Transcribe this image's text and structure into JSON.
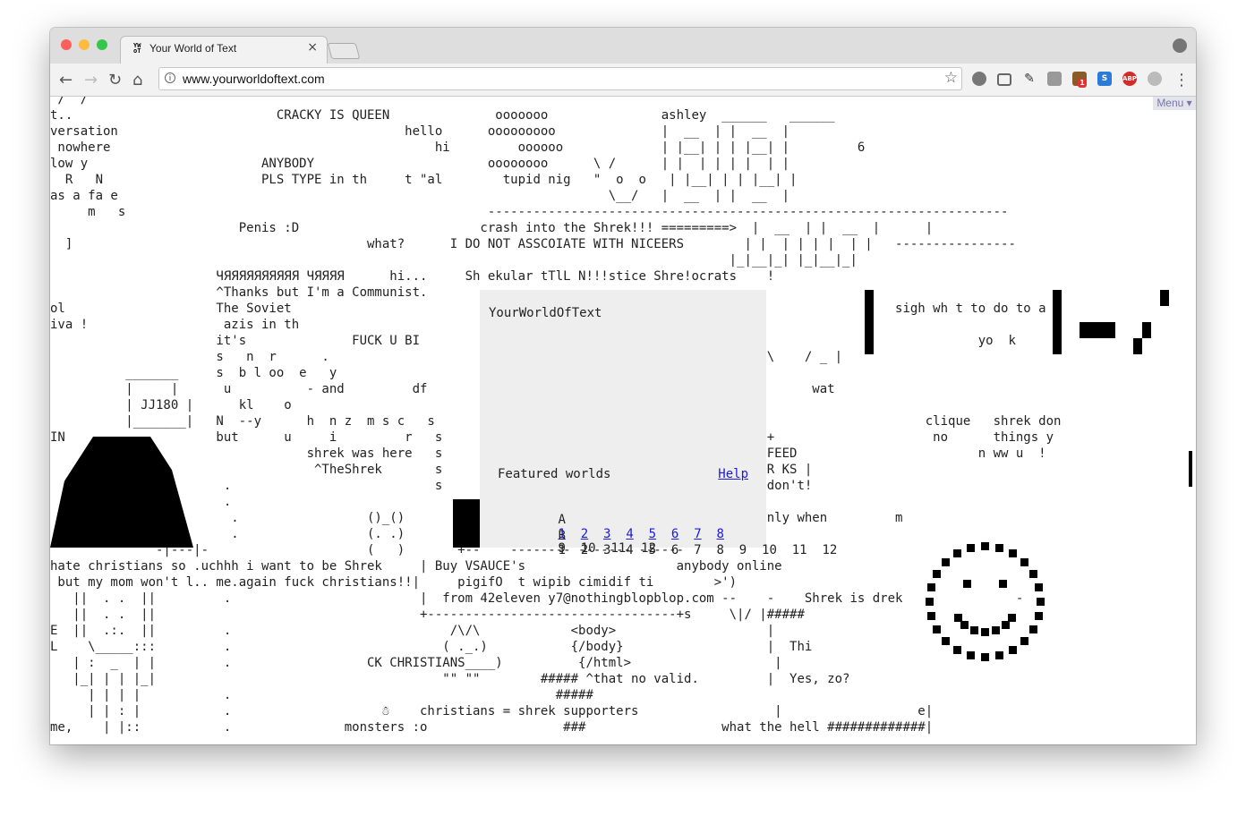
{
  "browser": {
    "tab_title": "Your World of Text",
    "tab_favicon": "YW oT",
    "tab_close": "×",
    "url": "www.yourworldoftext.com",
    "nav_back": "←",
    "nav_forward": "→",
    "nav_reload": "↻",
    "nav_home": "⌂",
    "info_glyph": "i",
    "bookmark_star": "☆",
    "extensions": [
      "refresh-icon",
      "screen-icon",
      "pin-icon",
      "camera-icon",
      "extension-badge-icon",
      "s-icon",
      "abp-icon",
      "cloud-icon"
    ],
    "abp_label": "ABP",
    "s_label": "S",
    "badge_count": "1",
    "menu_dots": "⋮"
  },
  "canvas": {
    "menu_label": "Menu ▾",
    "lines": [
      " /  /",
      "t..                           CRACKY IS QUEEN              ooooooo               ashley  ______   ______",
      "versation                                      hello      ooooooooo              |  __  | |  __  |",
      " nowhere                                           hi         oooooo             | |__| | | |__| |         6",
      "low y                       ANYBODY                       oooooooo      \\ /      | |  | | | |  | |",
      "  R   N                     PLS TYPE in th     t \"al        tupid nig   \"  o  o   | |__| | | |__| |",
      "as a fa e                                                                 \\__/   |  __  | |  __  |",
      "     m   s                                                ---------------------------------------------------------------------",
      "                         Penis :D                        crash into the Shrek!!! =========>  |  __  | |  __  |      |",
      "  ]                                       what?      I DO NOT ASSCOIATE WITH NICEERS        | |  | | | |  | |   ----------------",
      "                                                                                          |_|__|_| |_|__|_|",
      "                      ЧЯЯЯЯЯЯЯЯЯЯ ЧЯЯЯЯ      hi...     Sh ekular tTlL N!!!stice Shre!ocrats    !",
      "                      ^Thanks but I'm a Communist.",
      "ol                    The Soviet                                                                                sigh wh t to do to a",
      "iva !                  azis in th",
      "                      it's              FUCK U BI                                                                          yo  k",
      "                      s   n  r      .                                                      \\ / \\    / _ |",
      "          _______     s  b l oo  e   y",
      "          |     |      u          - and         df                                                   wat",
      "          | JJ180 |      kl    o",
      "          |_______|   N  --y      h  n z  m s c   s                                                                 clique   shrek don",
      "IN                    but      u     i         r   s                                        ---+                     no      things y",
      "                                  shrek was here   s                                    |      FEED                        n ww u  !",
      "                                   ^TheShrek       s                                    |  E SHR KS |",
      "                       .                           s                                    |   - -don't!",
      "                       .                                                                           ",
      "                        .                 ()_()                                              genly when         m",
      "                        .                 (. .)",
      "              -|---|-                     (   )       +--    -------- ------- ------",
      "hate christians so .uchhh i want to be Shrek     | Buy VSAUCE's                    anybody online",
      " but my mom won't l.. me.again fuck christians!!|     pigifO  t wipib cimidif ti        >')",
      "   ||  . .  ||         .                         |  from 42eleven y7@nothingblopblop.com --    -    Shrek is drek               -",
      "   ||  . .  ||                                   +---------------------------------+s     \\|/ |#####",
      "E  ||  .:.  ||         .                             /\\/\\            <body>                    |",
      "L    \\_____:::         .                            ( ._.)           {/body}                   |  Thi",
      "   | :  _  | |         .                  CK CHRISTIANS____)          {/html>                   |",
      "   |_| | | |_|                                      \"\" \"\"        ##### ^that no valid.         |  Yes, zo?",
      "     | | | |           .                                           #####",
      "     | | : |           .                    ☃    christians = shrek supporters                  |                  e|",
      "me,    | |::           .               monsters :o                  ###                  what the hell #############|"
    ]
  },
  "panel": {
    "title": "YourWorldOfText",
    "featured_label": "Featured worlds",
    "help_label": "Help",
    "row_a_label": "A",
    "row_b_label": "B",
    "row_a_links": [
      "1",
      "2",
      "3",
      "4",
      "5",
      "6",
      "7",
      "8"
    ],
    "row_a_plain": "9  10  11  12",
    "row_b_plain": "1  2  3  4  5  6  7  8  9  10  11  12"
  }
}
